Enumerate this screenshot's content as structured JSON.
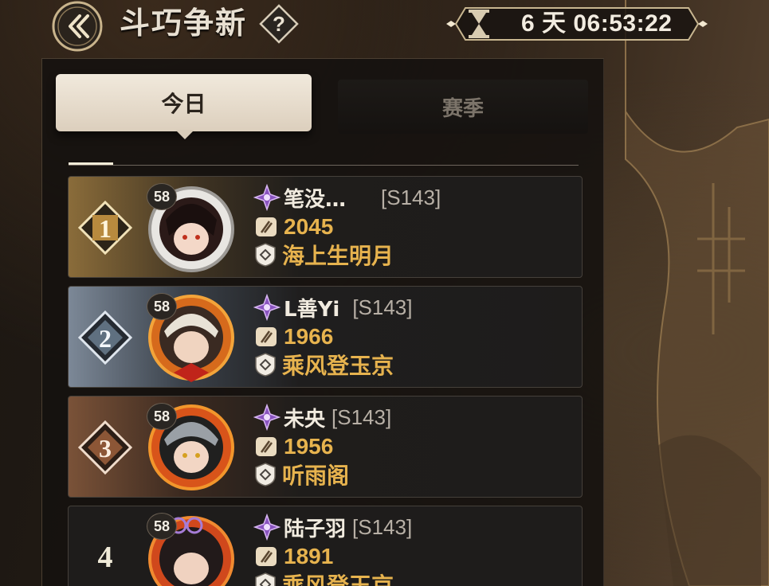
{
  "header": {
    "title": "斗巧争新",
    "help_symbol": "?",
    "timer": "6 天 06:53:22",
    "back_icon": "double-chevron-left-icon",
    "timer_icon": "hourglass-icon"
  },
  "tabs": [
    {
      "label": "今日",
      "active": true
    },
    {
      "label": "赛季",
      "active": false
    }
  ],
  "colors": {
    "gold_text": "#e7b34e",
    "rank1": "#8a6c3a",
    "rank2": "#7c8897",
    "rank3": "#7a5238"
  },
  "rankings": [
    {
      "rank": "1",
      "level": "58",
      "name": "笔没…",
      "server": "[S143]",
      "score": "2045",
      "guild": "海上生明月"
    },
    {
      "rank": "2",
      "level": "58",
      "name": "L善Yi",
      "server": "[S143]",
      "score": "1966",
      "guild": "乘风登玉京"
    },
    {
      "rank": "3",
      "level": "58",
      "name": "未央",
      "server": "[S143]",
      "score": "1956",
      "guild": "听雨阁"
    },
    {
      "rank": "4",
      "level": "58",
      "name": "陆子羽",
      "server": "[S143]",
      "score": "1891",
      "guild": "乘风登玉京"
    }
  ],
  "icons": {
    "title_icon": "purple-flower-icon",
    "score_icon": "scroll-icon",
    "guild_icon": "shield-icon"
  }
}
